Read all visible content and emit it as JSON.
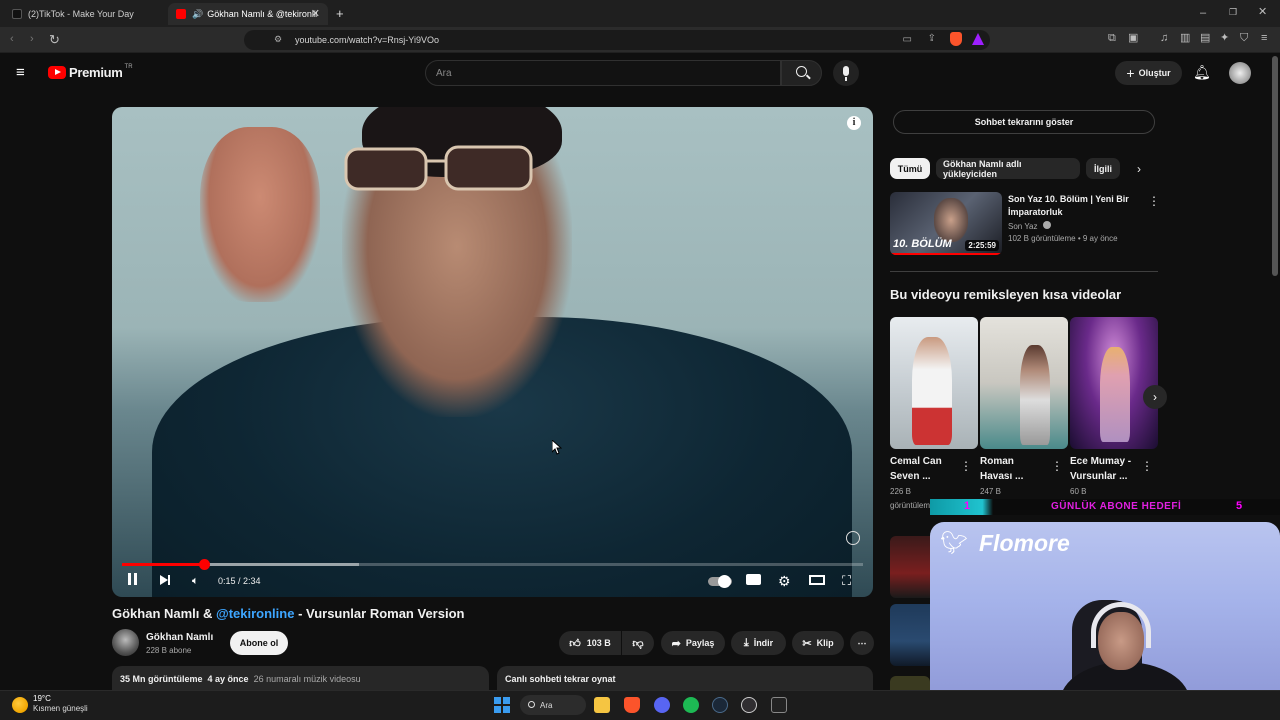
{
  "browser": {
    "tabs": [
      {
        "label": "(2)TikTok - Make Your Day"
      },
      {
        "label": "Gökhan Namlı & @tekironline"
      }
    ],
    "url": "youtube.com/watch?v=Rnsj-Yi9VOo"
  },
  "header": {
    "logo_text": "Premium",
    "logo_sup": "TR",
    "search_placeholder": "Ara",
    "create_label": "Oluştur"
  },
  "player": {
    "time": "0:15 / 2:34",
    "progress_fraction": 0.11,
    "buffered_fraction": 0.32
  },
  "video": {
    "title_prefix": "Gökhan Namlı & ",
    "title_link": "@tekironline",
    "title_suffix": " - Vursunlar Roman Version",
    "channel": "Gökhan Namlı",
    "subscribers": "228 B abone",
    "subscribe_label": "Abone ol",
    "likes": "103 B",
    "share_label": "Paylaş",
    "download_label": "İndir",
    "clip_label": "Klip",
    "views": "35 Mn görüntüleme",
    "age": "4 ay önce",
    "chart_rank": "26 numaralı müzik videosu",
    "chat_replay": "Canlı sohbeti tekrar oynat"
  },
  "sidebar": {
    "chat_button": "Sohbet tekrarını göster",
    "chips": [
      "Tümü",
      "Gökhan Namlı adlı yükleyiciden",
      "İlgili"
    ],
    "recommended": {
      "title": "Son Yaz 10. Bölüm | Yeni Bir İmparatorluk",
      "channel": "Son Yaz",
      "meta": "102 B görüntüleme • 9 ay önce",
      "duration": "2:25:59",
      "thumb_text": "10. BÖLÜM"
    },
    "shorts_heading": "Bu videoyu remiksleyen kısa videolar",
    "shorts": [
      {
        "title1": "Cemal Can",
        "title2": "Seven ...",
        "views": "226 B",
        "views2": "görüntüleme"
      },
      {
        "title1": "Roman",
        "title2": "Havası ...",
        "views": "247 B",
        "views2": "üleme"
      },
      {
        "title1": "Ece Mumay -",
        "title2": "Vursunlar ...",
        "views": "60 B",
        "views2": ""
      }
    ]
  },
  "overlay": {
    "banner_left": "1",
    "banner_text": "GÜNLÜK ABONE HEDEFİ",
    "banner_right": "5",
    "streamer": "Flomore"
  },
  "taskbar": {
    "temp": "19°C",
    "weather": "Kısmen güneşli",
    "search_label": "Ara"
  }
}
